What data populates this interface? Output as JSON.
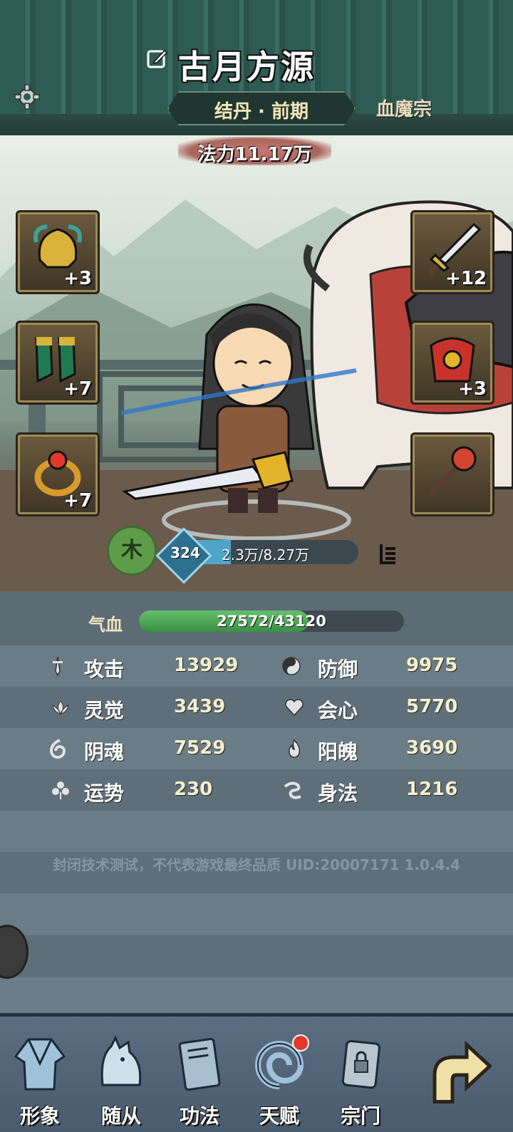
{
  "header": {
    "player_name": "古月方源",
    "realm": "结丹 · 前期",
    "sect": "血魔宗",
    "power_label": "法力11.17万"
  },
  "equipment": {
    "left": [
      {
        "icon": "helmet-icon",
        "level": "+3"
      },
      {
        "icon": "boots-icon",
        "level": "+7"
      },
      {
        "icon": "ring-icon",
        "level": "+7"
      }
    ],
    "right": [
      {
        "icon": "sword-icon",
        "level": "+12"
      },
      {
        "icon": "armor-icon",
        "level": "+3"
      },
      {
        "icon": "mace-icon",
        "level": ""
      }
    ]
  },
  "element": "木",
  "exp": {
    "level": "324",
    "text": "2.3万/8.27万",
    "fraction": 0.278
  },
  "hp": {
    "label": "气血",
    "text": "27572/43120",
    "fraction": 0.639
  },
  "stats": [
    {
      "left_icon": "dagger-icon",
      "left_name": "攻击",
      "left_value": "13929",
      "right_icon": "yinyang-icon",
      "right_name": "防御",
      "right_value": "9975"
    },
    {
      "left_icon": "lotus-icon",
      "left_name": "灵觉",
      "left_value": "3439",
      "right_icon": "heart-icon",
      "right_name": "会心",
      "right_value": "5770"
    },
    {
      "left_icon": "swirl-icon",
      "left_name": "阴魂",
      "left_value": "7529",
      "right_icon": "flame-icon",
      "right_name": "阳魄",
      "right_value": "3690"
    },
    {
      "left_icon": "clover-icon",
      "left_name": "运势",
      "left_value": "230",
      "right_icon": "wind-icon",
      "right_name": "身法",
      "right_value": "1216"
    }
  ],
  "watermark": "封闭技术测试，不代表游戏最终品质 UID:20007171 1.0.4.4",
  "nav": [
    {
      "label": "形象",
      "icon": "robe-icon"
    },
    {
      "label": "随从",
      "icon": "wolf-icon"
    },
    {
      "label": "功法",
      "icon": "book-icon"
    },
    {
      "label": "天赋",
      "icon": "vortex-icon"
    },
    {
      "label": "宗门",
      "icon": "scroll-lock-icon"
    },
    {
      "label": "",
      "icon": "return-arrow-icon"
    }
  ]
}
